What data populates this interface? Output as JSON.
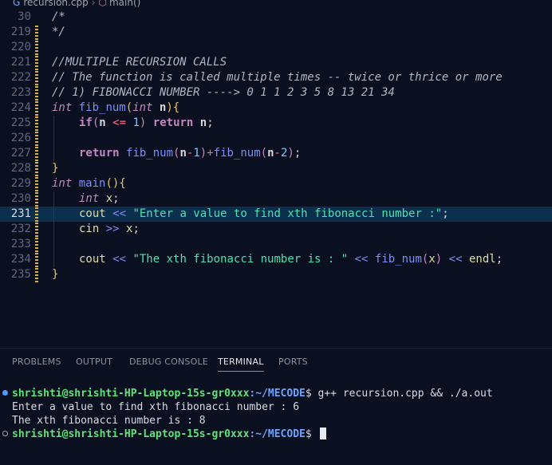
{
  "breadcrumb": {
    "file": "recursion.cpp",
    "symbol": "main()"
  },
  "editor": {
    "active_line": 231,
    "lines": [
      {
        "no": "30"
      },
      {
        "no": "219"
      },
      {
        "no": "220"
      },
      {
        "no": "221"
      },
      {
        "no": "222"
      },
      {
        "no": "223"
      },
      {
        "no": "224"
      },
      {
        "no": "225"
      },
      {
        "no": "226"
      },
      {
        "no": "227"
      },
      {
        "no": "228"
      },
      {
        "no": "229"
      },
      {
        "no": "230"
      },
      {
        "no": "231"
      },
      {
        "no": "232"
      },
      {
        "no": "233"
      },
      {
        "no": "234"
      },
      {
        "no": "235"
      }
    ],
    "code": {
      "l30": "/*",
      "l219": "*/",
      "l221": "//MULTIPLE RECURSION CALLS",
      "l222": "// The function is called multiple times -- twice or thrice or more",
      "l223": "// 1) FIBONACCI NUMBER ----> 0 1 1 2 3 5 8 13 21 34",
      "t_int": "int",
      "t_fib": "fib_num",
      "t_n": "n",
      "t_if": "if",
      "t_return": "return",
      "t_main": "main",
      "t_x": "x",
      "t_cout": "cout",
      "t_cin": "cin",
      "t_endl": "endl",
      "s231": "\"Enter a value to find xth fibonacci number :\"",
      "s234": "\"The xth fibonacci number is : \"",
      "num1": "1",
      "num2": "2"
    }
  },
  "panel": {
    "tabs": [
      "PROBLEMS",
      "OUTPUT",
      "DEBUG CONSOLE",
      "TERMINAL",
      "PORTS"
    ],
    "active_tab": "TERMINAL",
    "terminal": {
      "user_host": "shrishti@shrishti-HP-Laptop-15s-gr0xxx",
      "path": ":~/MECODE",
      "command": "$ g++ recursion.cpp && ./a.out",
      "output1": "Enter a value to find xth fibonacci number : 6",
      "output2": "The xth fibonacci number is : 8",
      "prompt_end": "$ "
    }
  },
  "colors": {
    "accent": "#4a9bff",
    "active_line_bg": "#0d2f4e",
    "prompt_green": "#5fe37a",
    "prompt_blue": "#6aa2ff"
  }
}
